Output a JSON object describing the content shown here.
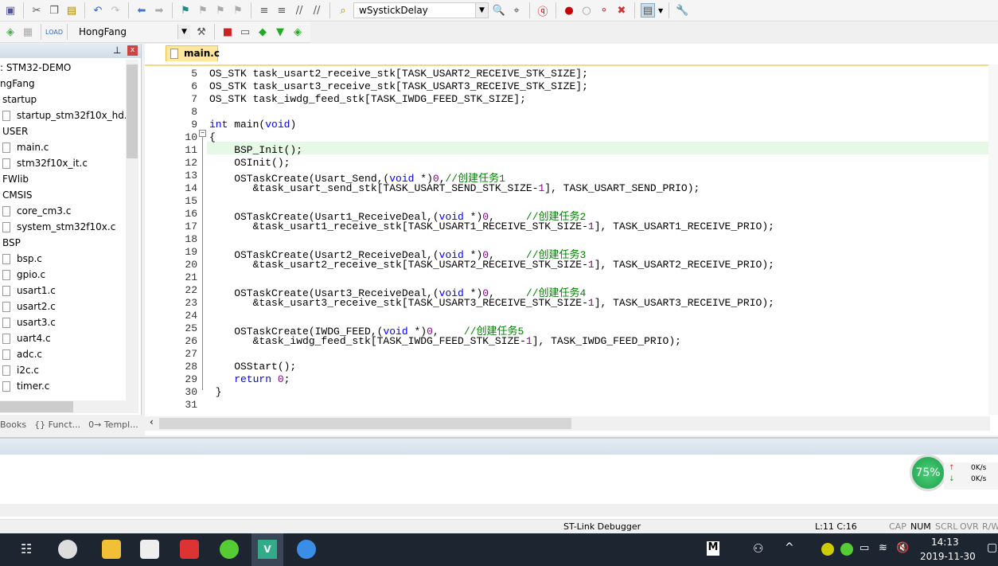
{
  "toolbar1": {
    "target_function": "wSystickDelay"
  },
  "toolbar2": {
    "target": "HongFang"
  },
  "project": {
    "items": [
      {
        "label": ": STM32-DEMO",
        "level": 0,
        "file": false
      },
      {
        "label": "ngFang",
        "level": 0,
        "file": false
      },
      {
        "label": "startup",
        "level": 1,
        "file": false
      },
      {
        "label": "startup_stm32f10x_hd.s",
        "level": 2,
        "file": true
      },
      {
        "label": "USER",
        "level": 1,
        "file": false
      },
      {
        "label": "main.c",
        "level": 2,
        "file": true
      },
      {
        "label": "stm32f10x_it.c",
        "level": 2,
        "file": true
      },
      {
        "label": "FWlib",
        "level": 1,
        "file": false
      },
      {
        "label": "CMSIS",
        "level": 1,
        "file": false
      },
      {
        "label": "core_cm3.c",
        "level": 2,
        "file": true
      },
      {
        "label": "system_stm32f10x.c",
        "level": 2,
        "file": true
      },
      {
        "label": "BSP",
        "level": 1,
        "file": false
      },
      {
        "label": "bsp.c",
        "level": 2,
        "file": true
      },
      {
        "label": "gpio.c",
        "level": 2,
        "file": true
      },
      {
        "label": "usart1.c",
        "level": 2,
        "file": true
      },
      {
        "label": "usart2.c",
        "level": 2,
        "file": true
      },
      {
        "label": "usart3.c",
        "level": 2,
        "file": true
      },
      {
        "label": "uart4.c",
        "level": 2,
        "file": true
      },
      {
        "label": "adc.c",
        "level": 2,
        "file": true
      },
      {
        "label": "i2c.c",
        "level": 2,
        "file": true
      },
      {
        "label": "timer.c",
        "level": 2,
        "file": true
      }
    ],
    "tabs": [
      "Books",
      "{} Funct...",
      "0→ Templ..."
    ]
  },
  "editor": {
    "tab": "main.c",
    "current_line": 11,
    "lines": [
      {
        "n": 5,
        "s": [
          [
            "OS_STK task_usart2_receive_stk[TASK_USART2_RECEIVE_STK_SIZE];",
            ""
          ]
        ]
      },
      {
        "n": 6,
        "s": [
          [
            "OS_STK task_usart3_receive_stk[TASK_USART3_RECEIVE_STK_SIZE];",
            ""
          ]
        ]
      },
      {
        "n": 7,
        "s": [
          [
            "OS_STK task_iwdg_feed_stk[TASK_IWDG_FEED_STK_SIZE];",
            ""
          ]
        ]
      },
      {
        "n": 8,
        "s": []
      },
      {
        "n": 9,
        "s": [
          [
            "int",
            "kw"
          ],
          [
            " main(",
            ""
          ],
          [
            "void",
            "kw"
          ],
          [
            ")",
            ""
          ]
        ]
      },
      {
        "n": 10,
        "s": [
          [
            "{",
            ""
          ]
        ]
      },
      {
        "n": 11,
        "s": [
          [
            "    BSP_Init();",
            ""
          ]
        ]
      },
      {
        "n": 12,
        "s": [
          [
            "    OSInit();",
            ""
          ]
        ]
      },
      {
        "n": 13,
        "s": [
          [
            "    OSTaskCreate(Usart_Send,(",
            ""
          ],
          [
            "void",
            "kw"
          ],
          [
            " *)",
            ""
          ],
          [
            "0",
            "num"
          ],
          [
            ",",
            ""
          ],
          [
            "//创建任务1",
            "cm"
          ]
        ]
      },
      {
        "n": 14,
        "s": [
          [
            "       &task_usart_send_stk[TASK_USART_SEND_STK_SIZE-",
            ""
          ],
          [
            "1",
            "num"
          ],
          [
            "], TASK_USART_SEND_PRIO);",
            ""
          ]
        ]
      },
      {
        "n": 15,
        "s": []
      },
      {
        "n": 16,
        "s": [
          [
            "    OSTaskCreate(Usart1_ReceiveDeal,(",
            ""
          ],
          [
            "void",
            "kw"
          ],
          [
            " *)",
            ""
          ],
          [
            "0",
            "num"
          ],
          [
            ",     ",
            ""
          ],
          [
            "//创建任务2",
            "cm"
          ]
        ]
      },
      {
        "n": 17,
        "s": [
          [
            "       &task_usart1_receive_stk[TASK_USART1_RECEIVE_STK_SIZE-",
            ""
          ],
          [
            "1",
            "num"
          ],
          [
            "], TASK_USART1_RECEIVE_PRIO);",
            ""
          ]
        ]
      },
      {
        "n": 18,
        "s": []
      },
      {
        "n": 19,
        "s": [
          [
            "    OSTaskCreate(Usart2_ReceiveDeal,(",
            ""
          ],
          [
            "void",
            "kw"
          ],
          [
            " *)",
            ""
          ],
          [
            "0",
            "num"
          ],
          [
            ",     ",
            ""
          ],
          [
            "//创建任务3",
            "cm"
          ]
        ]
      },
      {
        "n": 20,
        "s": [
          [
            "       &task_usart2_receive_stk[TASK_USART2_RECEIVE_STK_SIZE-",
            ""
          ],
          [
            "1",
            "num"
          ],
          [
            "], TASK_USART2_RECEIVE_PRIO);",
            ""
          ]
        ]
      },
      {
        "n": 21,
        "s": []
      },
      {
        "n": 22,
        "s": [
          [
            "    OSTaskCreate(Usart3_ReceiveDeal,(",
            ""
          ],
          [
            "void",
            "kw"
          ],
          [
            " *)",
            ""
          ],
          [
            "0",
            "num"
          ],
          [
            ",     ",
            ""
          ],
          [
            "//创建任务4",
            "cm"
          ]
        ]
      },
      {
        "n": 23,
        "s": [
          [
            "       &task_usart3_receive_stk[TASK_USART3_RECEIVE_STK_SIZE-",
            ""
          ],
          [
            "1",
            "num"
          ],
          [
            "], TASK_USART3_RECEIVE_PRIO);",
            ""
          ]
        ]
      },
      {
        "n": 24,
        "s": []
      },
      {
        "n": 25,
        "s": [
          [
            "    OSTaskCreate(IWDG_FEED,(",
            ""
          ],
          [
            "void",
            "kw"
          ],
          [
            " *)",
            ""
          ],
          [
            "0",
            "num"
          ],
          [
            ",    ",
            ""
          ],
          [
            "//创建任务5",
            "cm"
          ]
        ]
      },
      {
        "n": 26,
        "s": [
          [
            "       &task_iwdg_feed_stk[TASK_IWDG_FEED_STK_SIZE-",
            ""
          ],
          [
            "1",
            "num"
          ],
          [
            "], TASK_IWDG_FEED_PRIO);",
            ""
          ]
        ]
      },
      {
        "n": 27,
        "s": []
      },
      {
        "n": 28,
        "s": [
          [
            "    OSStart();",
            ""
          ]
        ]
      },
      {
        "n": 29,
        "s": [
          [
            "    ",
            ""
          ],
          [
            "return",
            "kw"
          ],
          [
            " ",
            ""
          ],
          [
            "0",
            "num"
          ],
          [
            ";",
            ""
          ]
        ]
      },
      {
        "n": 30,
        "s": [
          [
            " }",
            ""
          ]
        ]
      },
      {
        "n": 31,
        "s": []
      }
    ]
  },
  "netmon": {
    "percent": "75%",
    "up": "0K/s",
    "down": "0K/s"
  },
  "status": {
    "debugger": "ST-Link Debugger",
    "position": "L:11 C:16",
    "cap": "CAP",
    "num": "NUM",
    "scrl": "SCRL",
    "ovr": "OVR",
    "rw": "R/W"
  },
  "taskbar": {
    "time": "14:13",
    "date": "2019-11-30",
    "ime": "M"
  }
}
